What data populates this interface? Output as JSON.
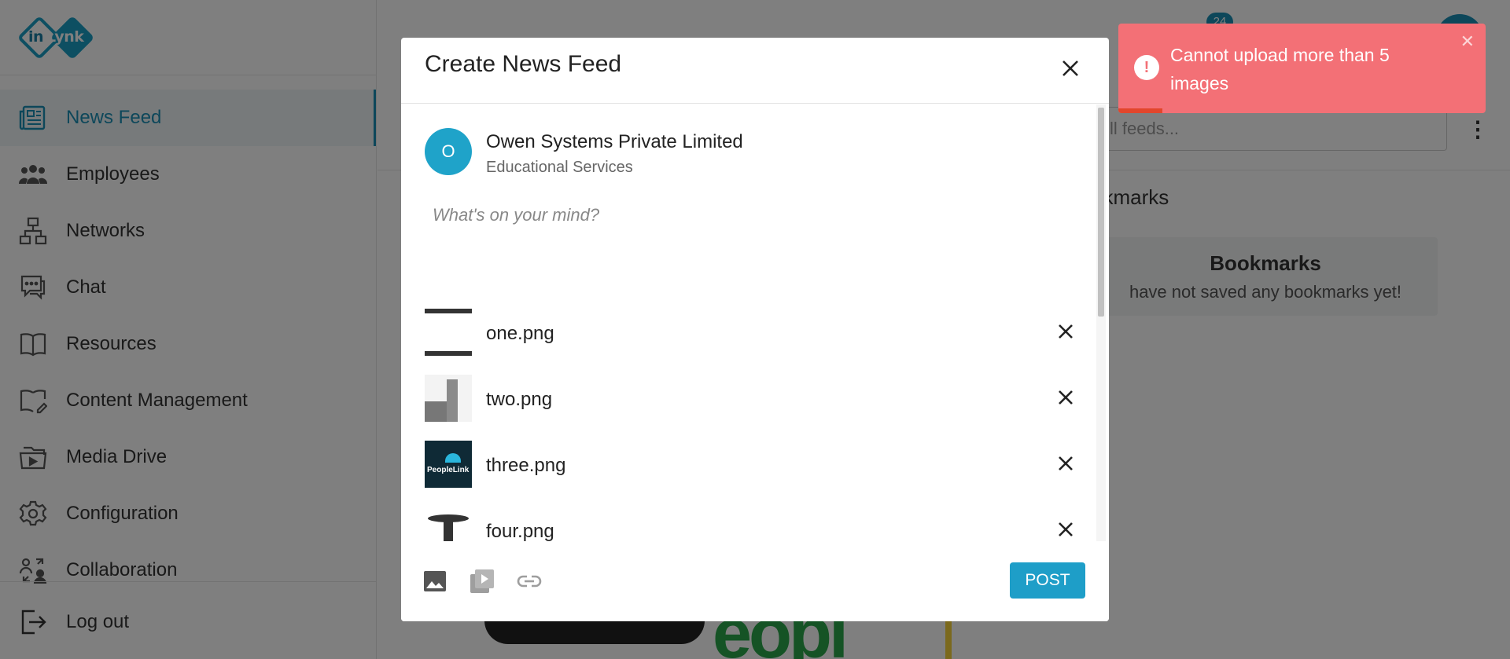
{
  "app": {
    "logo_text_left": "in",
    "logo_text_right": "Lynk"
  },
  "sidebar": {
    "items": [
      {
        "label": "News Feed",
        "icon": "newspaper-icon",
        "active": true
      },
      {
        "label": "Employees",
        "icon": "people-icon"
      },
      {
        "label": "Networks",
        "icon": "network-icon"
      },
      {
        "label": "Chat",
        "icon": "chat-icon"
      },
      {
        "label": "Resources",
        "icon": "book-icon"
      },
      {
        "label": "Content Management",
        "icon": "content-icon"
      },
      {
        "label": "Media Drive",
        "icon": "folder-media-icon"
      },
      {
        "label": "Configuration",
        "icon": "gear-icon"
      },
      {
        "label": "Collaboration",
        "icon": "collaboration-icon"
      }
    ],
    "logout_label": "Log out"
  },
  "header": {
    "notification_count": "24"
  },
  "main": {
    "search_placeholder": "ll feeds...",
    "bookmarks_heading": "okmarks",
    "bookmarks_card_title": "Bookmarks",
    "bookmarks_card_text": "have not saved any bookmarks yet!"
  },
  "modal": {
    "title": "Create News Feed",
    "org": {
      "avatar_letter": "O",
      "name": "Owen Systems Private Limited",
      "category": "Educational Services"
    },
    "input_placeholder": "What's on your mind?",
    "input_value": "",
    "files": [
      {
        "name": "one.png"
      },
      {
        "name": "two.png"
      },
      {
        "name": "three.png",
        "thumb_text": "PeopleLink"
      },
      {
        "name": "four.png"
      }
    ],
    "post_label": "POST"
  },
  "toast": {
    "message": "Cannot upload more than 5 images",
    "icon": "exclamation-icon",
    "progress": 0.12
  },
  "colors": {
    "accent": "#1a8fb5",
    "post_button": "#1e9ec8",
    "toast_bg": "#f37076",
    "toast_progress": "#e2462c"
  }
}
